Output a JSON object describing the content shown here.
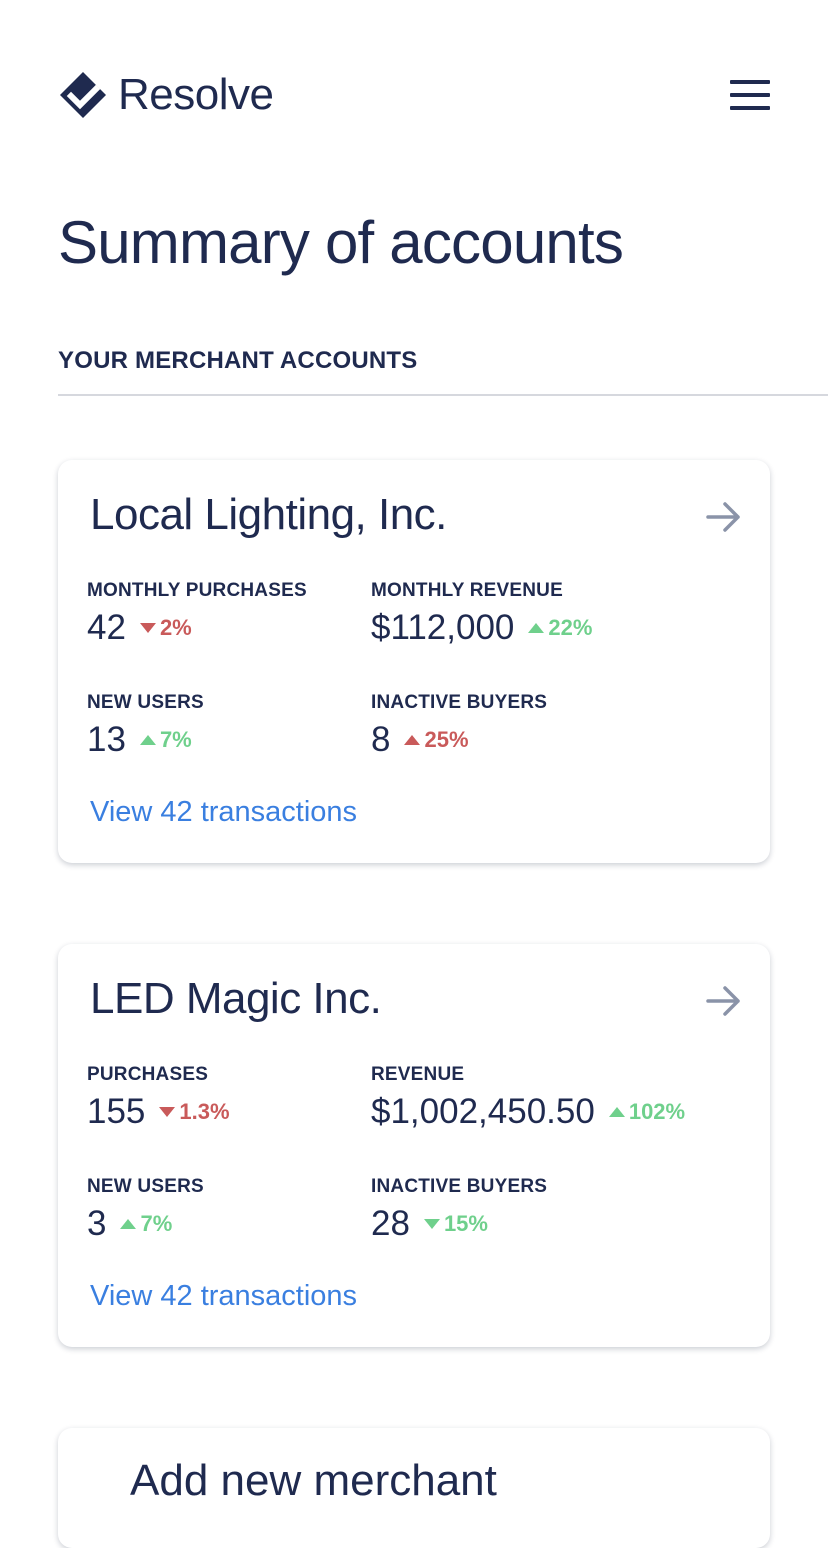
{
  "app": {
    "name": "Resolve"
  },
  "page": {
    "title": "Summary of accounts"
  },
  "section": {
    "label": "YOUR MERCHANT ACCOUNTS"
  },
  "colors": {
    "primary": "#1f2a4f",
    "link": "#3a7fe0",
    "positive": "#6fd08c",
    "negative": "#c95a5a"
  },
  "icons": {
    "logo": "resolve-logo-icon",
    "menu": "hamburger-menu-icon",
    "arrow": "arrow-right-icon",
    "up": "triangle-up-icon",
    "down": "triangle-down-icon"
  },
  "accounts": [
    {
      "name": "Local Lighting, Inc.",
      "stats": [
        {
          "label": "MONTHLY PURCHASES",
          "value": "42",
          "delta": "2%",
          "direction": "down",
          "tone": "red"
        },
        {
          "label": "MONTHLY REVENUE",
          "value": "$112,000",
          "delta": "22%",
          "direction": "up",
          "tone": "green"
        },
        {
          "label": "NEW USERS",
          "value": "13",
          "delta": "7%",
          "direction": "up",
          "tone": "green"
        },
        {
          "label": "INACTIVE BUYERS",
          "value": "8",
          "delta": "25%",
          "direction": "up",
          "tone": "red"
        }
      ],
      "link": "View 42 transactions"
    },
    {
      "name": "LED Magic Inc.",
      "stats": [
        {
          "label": "PURCHASES",
          "value": "155",
          "delta": "1.3%",
          "direction": "down",
          "tone": "red"
        },
        {
          "label": "REVENUE",
          "value": "$1,002,450.50",
          "delta": "102%",
          "direction": "up",
          "tone": "green"
        },
        {
          "label": "NEW USERS",
          "value": "3",
          "delta": "7%",
          "direction": "up",
          "tone": "green"
        },
        {
          "label": "INACTIVE BUYERS",
          "value": "28",
          "delta": "15%",
          "direction": "down",
          "tone": "green"
        }
      ],
      "link": "View 42 transactions"
    }
  ],
  "partial_card": {
    "title": "Add new merchant"
  }
}
